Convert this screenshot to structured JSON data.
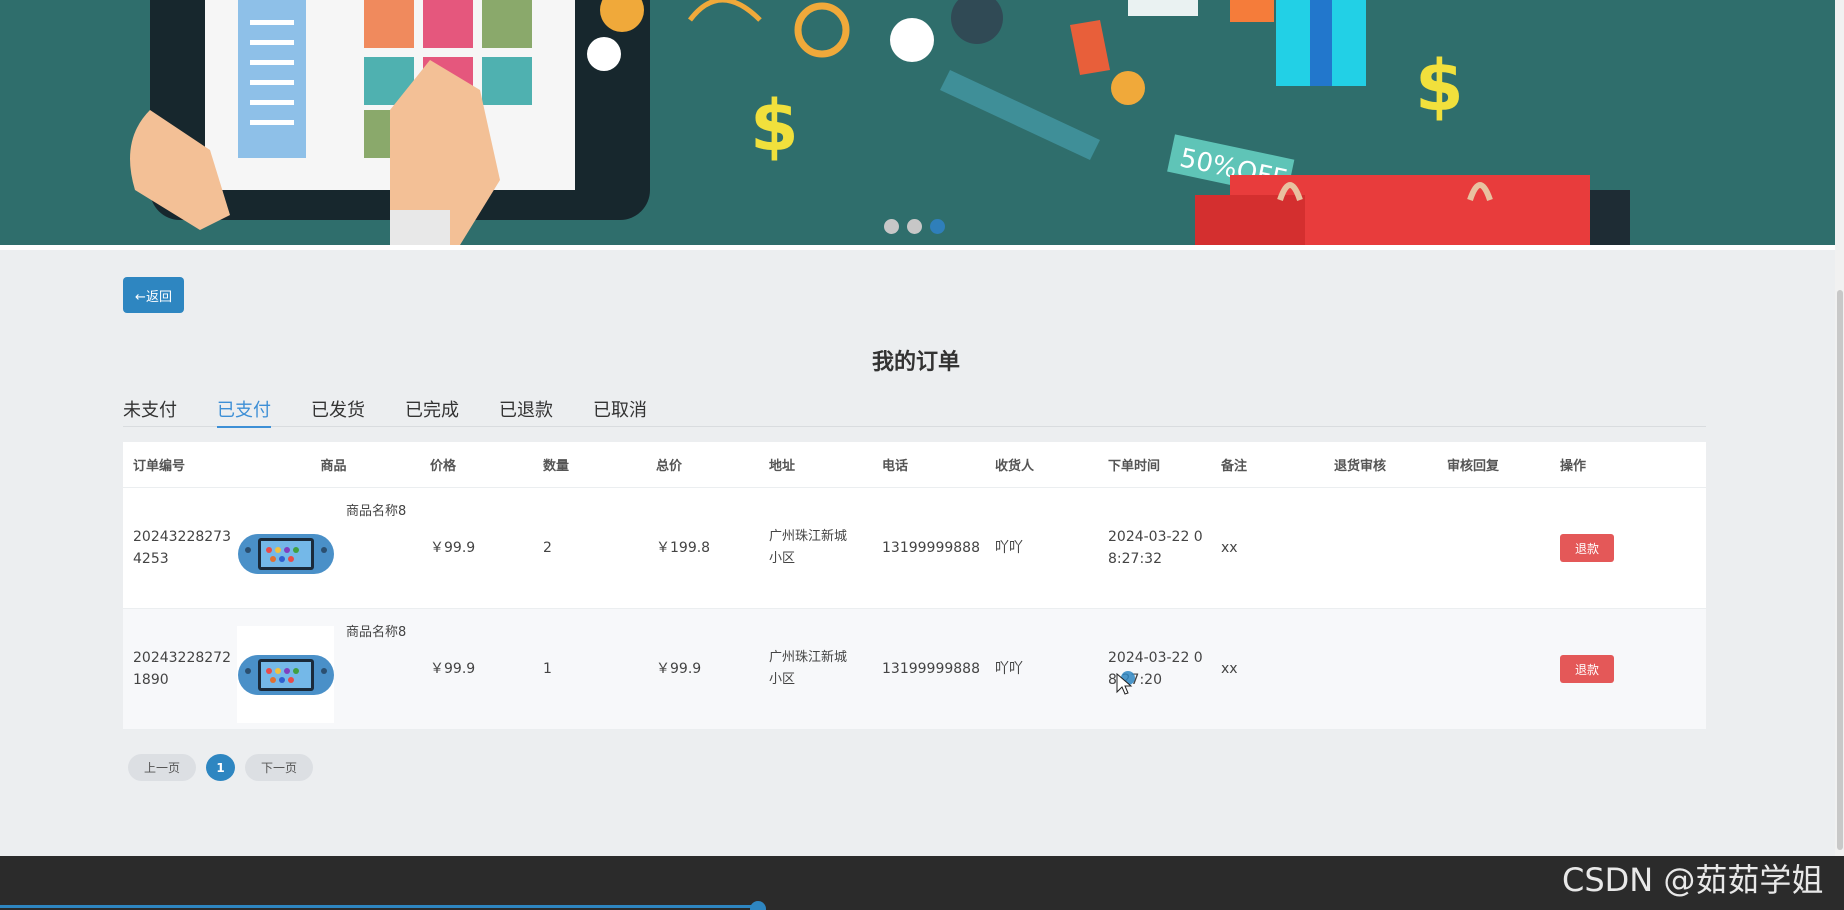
{
  "banner": {
    "dots": [
      {
        "label": "slide-1",
        "active": false
      },
      {
        "label": "slide-2",
        "active": false
      },
      {
        "label": "slide-3",
        "active": true
      }
    ],
    "badge_text": "50%OFF"
  },
  "back_button": "←返回",
  "page_title": "我的订单",
  "tabs": [
    "未支付",
    "已支付",
    "已发货",
    "已完成",
    "已退款",
    "已取消"
  ],
  "active_tab": 1,
  "table": {
    "headers": [
      "订单编号",
      "商品",
      "价格",
      "数量",
      "总价",
      "地址",
      "电话",
      "收货人",
      "下单时间",
      "备注",
      "退货审核",
      "审核回复",
      "操作"
    ],
    "rows": [
      {
        "order_no": "20243228273\n4253",
        "goods_name": "商品名称8",
        "price": "￥99.9",
        "qty": "2",
        "total": "￥199.8",
        "address": "广州珠江新城\n小区",
        "phone": "13199999888",
        "receiver": "吖吖",
        "time": "2024-03-22 0\n8:27:32",
        "remark": "xx",
        "review": "",
        "reply": "",
        "action": "退款"
      },
      {
        "order_no": "20243228272\n1890",
        "goods_name": "商品名称8",
        "price": "￥99.9",
        "qty": "1",
        "total": "￥99.9",
        "address": "广州珠江新城\n小区",
        "phone": "13199999888",
        "receiver": "吖吖",
        "time": "2024-03-22 0\n8:27:20",
        "remark": "xx",
        "review": "",
        "reply": "",
        "action": "退款"
      }
    ]
  },
  "pagination": {
    "prev": "上一页",
    "current": "1",
    "next": "下一页"
  },
  "watermark": "CSDN @茹茹学姐",
  "colors": {
    "accent": "#2e86c1",
    "tab_active": "#3d8fd6",
    "danger": "#e45858",
    "banner_bg": "#2f6e6c",
    "footer_bg": "#2b2b2b"
  }
}
